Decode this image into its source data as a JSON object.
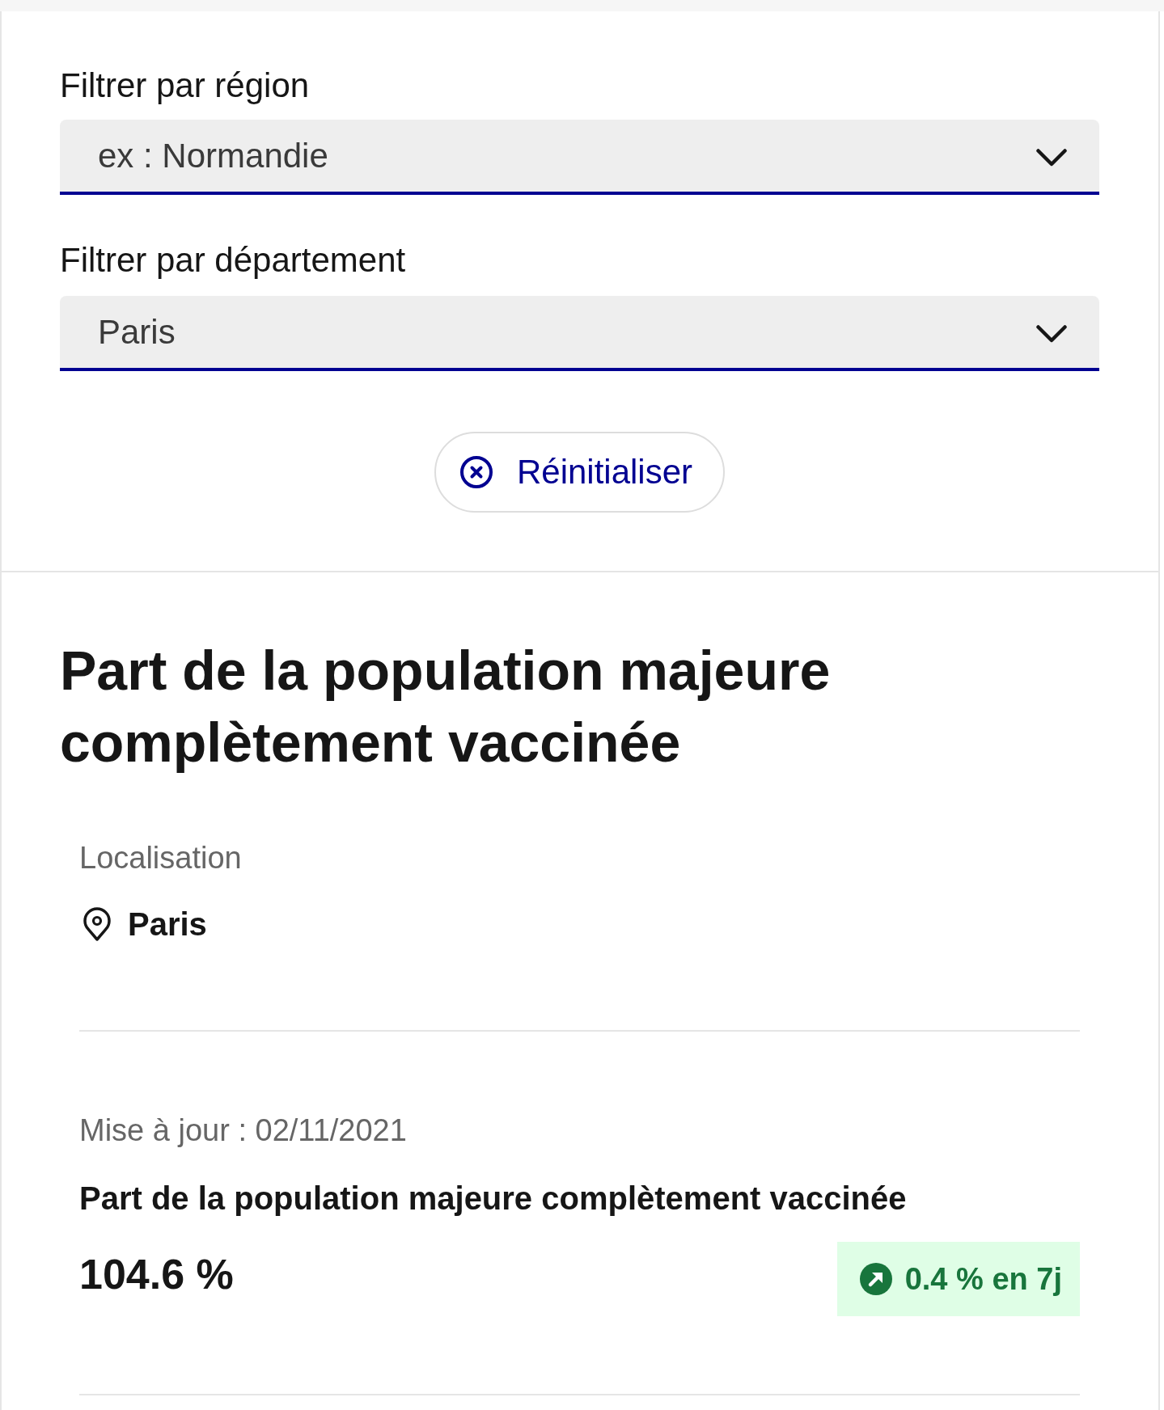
{
  "filters": [
    {
      "label": "Filtrer par région",
      "placeholder": "ex : Normandie"
    },
    {
      "label": "Filtrer par département",
      "value": "Paris"
    }
  ],
  "reset_button": {
    "label": "Réinitialiser"
  },
  "indicator": {
    "title": "Part de la population majeure complètement vaccinée",
    "location": {
      "label": "Localisation",
      "value": "Paris"
    },
    "updated": "Mise à jour : 02/11/2021",
    "metric": {
      "name": "Part de la population majeure complètement vaccinée",
      "value": "104.6 %",
      "trend": {
        "kind": "up",
        "text": "0.4 % en 7j"
      }
    }
  }
}
